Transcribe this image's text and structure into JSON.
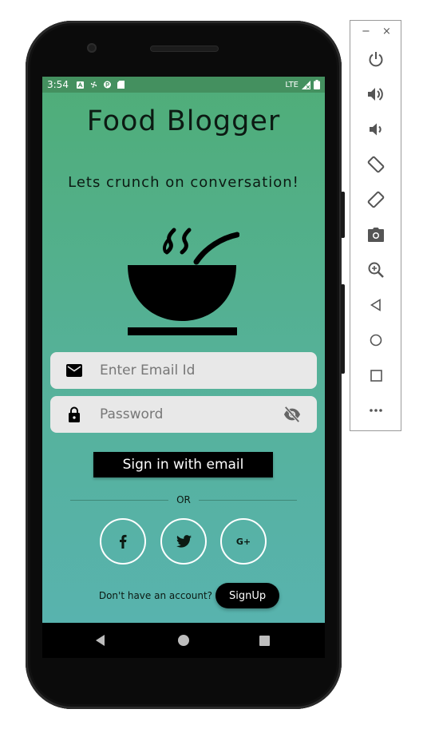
{
  "status_bar": {
    "time": "3:54",
    "network": "LTE",
    "icons": [
      "a-notification-icon",
      "fan-icon",
      "p-notification-icon",
      "sdcard-icon",
      "signal-icon",
      "battery-icon"
    ]
  },
  "app": {
    "title": "Food Blogger",
    "tagline": "Lets crunch on conversation!",
    "logo_icon": "soup-bowl-icon",
    "email_field": {
      "placeholder": "Enter Email Id",
      "value": "",
      "icon": "mail-icon"
    },
    "password_field": {
      "placeholder": "Password",
      "value": "",
      "icon": "lock-icon",
      "toggle_icon": "eye-off-icon"
    },
    "signin_label": "Sign in with email",
    "or_label": "OR",
    "social_buttons": [
      {
        "name": "facebook",
        "icon": "facebook-icon"
      },
      {
        "name": "twitter",
        "icon": "twitter-icon"
      },
      {
        "name": "google-plus",
        "icon": "google-plus-icon",
        "glyph": "G+"
      }
    ],
    "signup_prompt": "Don't have an account?",
    "signup_label": "SignUp"
  },
  "nav_bar": {
    "buttons": [
      "back-icon",
      "home-icon",
      "recents-icon"
    ]
  },
  "emulator_toolbar": {
    "window_controls": [
      "−",
      "×"
    ],
    "tools": [
      "power-icon",
      "volume-up-icon",
      "volume-down-icon",
      "rotate-left-icon",
      "rotate-right-icon",
      "camera-icon",
      "zoom-icon",
      "back-icon",
      "home-icon",
      "overview-icon",
      "more-icon"
    ]
  },
  "colors": {
    "gradient_top": "#4fad78",
    "gradient_bottom": "#58b3ae",
    "status_bar": "#44905f",
    "field_bg": "#e8e8e8",
    "button_bg": "#000000"
  }
}
